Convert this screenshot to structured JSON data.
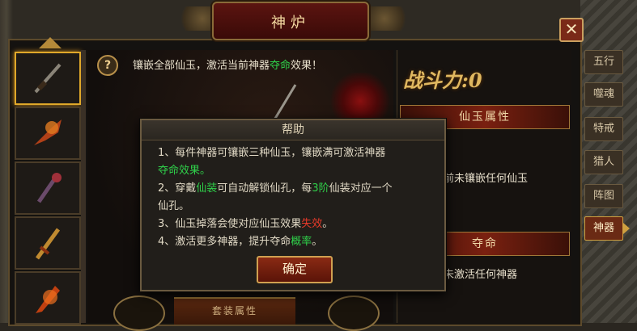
{
  "window": {
    "title": "神炉",
    "close_symbol": "✕"
  },
  "center": {
    "help_symbol": "?",
    "tip_prefix": "镶嵌全部仙玉，激活当前神器",
    "tip_highlight": "夺命",
    "tip_suffix": "效果！",
    "set_label": "套装属性"
  },
  "right_panel": {
    "power_label": "战斗力:",
    "power_value": "0",
    "jade_header": "仙玉属性",
    "jade_text": "暂未镶嵌任何仙玉",
    "jade_text_visible": "前未镶嵌任何仙玉",
    "duoming_header": "夺命",
    "duoming_text": "未激活任何神器"
  },
  "tabs": [
    {
      "label": "五行",
      "active": false
    },
    {
      "label": "噬魂",
      "active": false
    },
    {
      "label": "特戒",
      "active": false
    },
    {
      "label": "猎人",
      "active": false
    },
    {
      "label": "阵图",
      "active": false
    },
    {
      "label": "神器",
      "active": true
    }
  ],
  "slots": [
    {
      "icon": "blade-icon",
      "selected": true
    },
    {
      "icon": "axe-icon",
      "selected": false
    },
    {
      "icon": "staff-icon",
      "selected": false
    },
    {
      "icon": "sword-icon",
      "selected": false
    },
    {
      "icon": "flame-blade-icon",
      "selected": false
    }
  ],
  "dialog": {
    "title": "帮助",
    "line1_a": "1、每件神器可镶嵌三种仙玉，镶嵌满可激活神器",
    "line1_b": "夺命效果。",
    "line2_a": "2、穿戴",
    "line2_b": "仙装",
    "line2_c": "可自动解锁仙孔，每",
    "line2_d": "3阶",
    "line2_e": "仙装对应一个",
    "line2_f": "仙孔。",
    "line3_a": "3、仙玉掉落会使对应仙玉效果",
    "line3_b": "失效",
    "line3_c": "。",
    "line4_a": "4、激活更多神器，提升夺命",
    "line4_b": "概率",
    "line4_c": "。",
    "confirm_label": "确定"
  },
  "colors": {
    "highlight_green": "#2fd04a",
    "highlight_red": "#e83a2a",
    "gold": "#e0b860"
  }
}
